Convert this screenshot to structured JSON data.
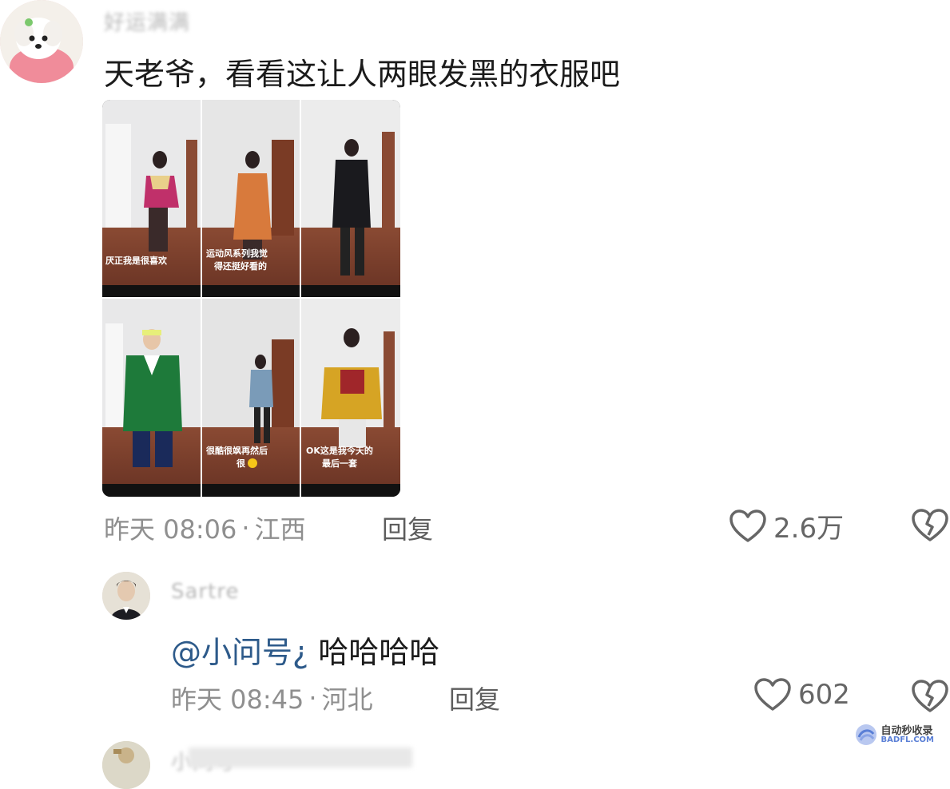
{
  "comments": [
    {
      "username": "好运满满",
      "content": "天老爷，看看这让人两眼发黑的衣服吧",
      "time": "昨天 08:06",
      "location": "江西",
      "reply_label": "回复",
      "likes": "2.6万",
      "photo_captions": [
        "厌正我是很喜欢",
        "运动风系列我觉得还挺好看的",
        "",
        "",
        "很酷很飒再然后很",
        "OK这是我今天的最后一套"
      ]
    },
    {
      "username": "Sartre",
      "mention": "@小问号¿",
      "content": "哈哈哈哈",
      "time": "昨天 08:45",
      "location": "河北",
      "reply_label": "回复",
      "likes": "602"
    },
    {
      "username": "小问号"
    }
  ],
  "watermark": {
    "top": "自动秒收录",
    "bottom": "BADFL.COM"
  },
  "colors": {
    "mention": "#2d5a8a",
    "meta": "#8f8f8f",
    "text": "#1b1b1b"
  },
  "icons": {
    "like": "heart-outline-icon",
    "dislike": "broken-heart-icon"
  }
}
